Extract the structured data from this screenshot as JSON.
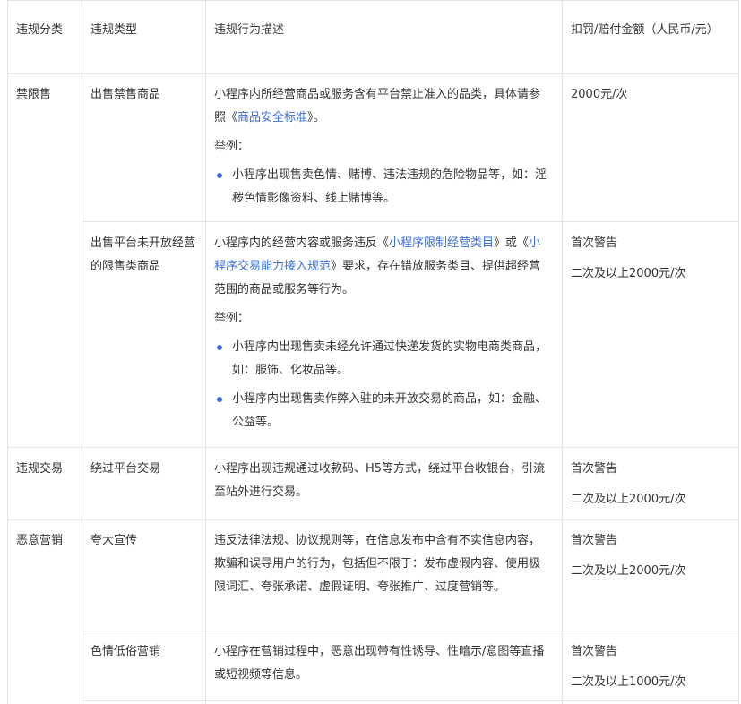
{
  "header": {
    "category": "违规分类",
    "type": "违规类型",
    "description": "违规行为描述",
    "penalty": "扣罚/赔付金额（人民币/元）"
  },
  "rows": [
    {
      "category": "禁限售",
      "type": "出售禁售商品",
      "desc_pre": "小程序内所经营商品或服务含有平台禁止准入的品类，具体请参照《",
      "desc_link": "商品安全标准",
      "desc_post": "》。",
      "example_label": "举例：",
      "bullets": [
        "小程序出现售卖色情、赌博、违法违规的危险物品等，如：淫秽色情影像资料、线上赌博等。"
      ],
      "penalty": [
        "2000元/次"
      ]
    },
    {
      "category": "",
      "type": "出售平台未开放经营的限售类商品",
      "desc_pre": "小程序内的经营内容或服务违反《",
      "desc_link": "小程序限制经营类目",
      "desc_mid": "》或《",
      "desc_link2": "小程序交易能力接入规范",
      "desc_post": "》要求，存在错放服务类目、提供超经营范围的商品或服务等行为。",
      "example_label": "举例：",
      "bullets": [
        "小程序内出现售卖未经允许通过快递发货的实物电商类商品，如：服饰、化妆品等。",
        "小程序内出现售卖作弊入驻的未开放交易的商品，如：金融、公益等。"
      ],
      "penalty": [
        "首次警告",
        "二次及以上2000元/次"
      ]
    },
    {
      "category": "违规交易",
      "type": "绕过平台交易",
      "desc": "小程序出现违规通过收款码、H5等方式，绕过平台收银台，引流至站外进行交易。",
      "penalty": [
        "首次警告",
        "二次及以上2000元/次"
      ]
    },
    {
      "category": "恶意营销",
      "type": "夸大宣传",
      "desc": "违反法律法规、协议规则等，在信息发布中含有不实信息内容，欺骗和误导用户的行为，包括但不限于：发布虚假内容、使用极限词汇、夸张承诺、虚假证明、夸张推广、过度营销等。",
      "penalty": [
        "首次警告",
        "二次及以上2000元/次"
      ]
    },
    {
      "category": "",
      "type": "色情低俗营销",
      "desc": "小程序在营销过程中，恶意出现带有性诱导、性暗示/意图等直播或短视频等信息。",
      "penalty": [
        "首次警告",
        "二次及以上1000元/次"
      ]
    }
  ]
}
